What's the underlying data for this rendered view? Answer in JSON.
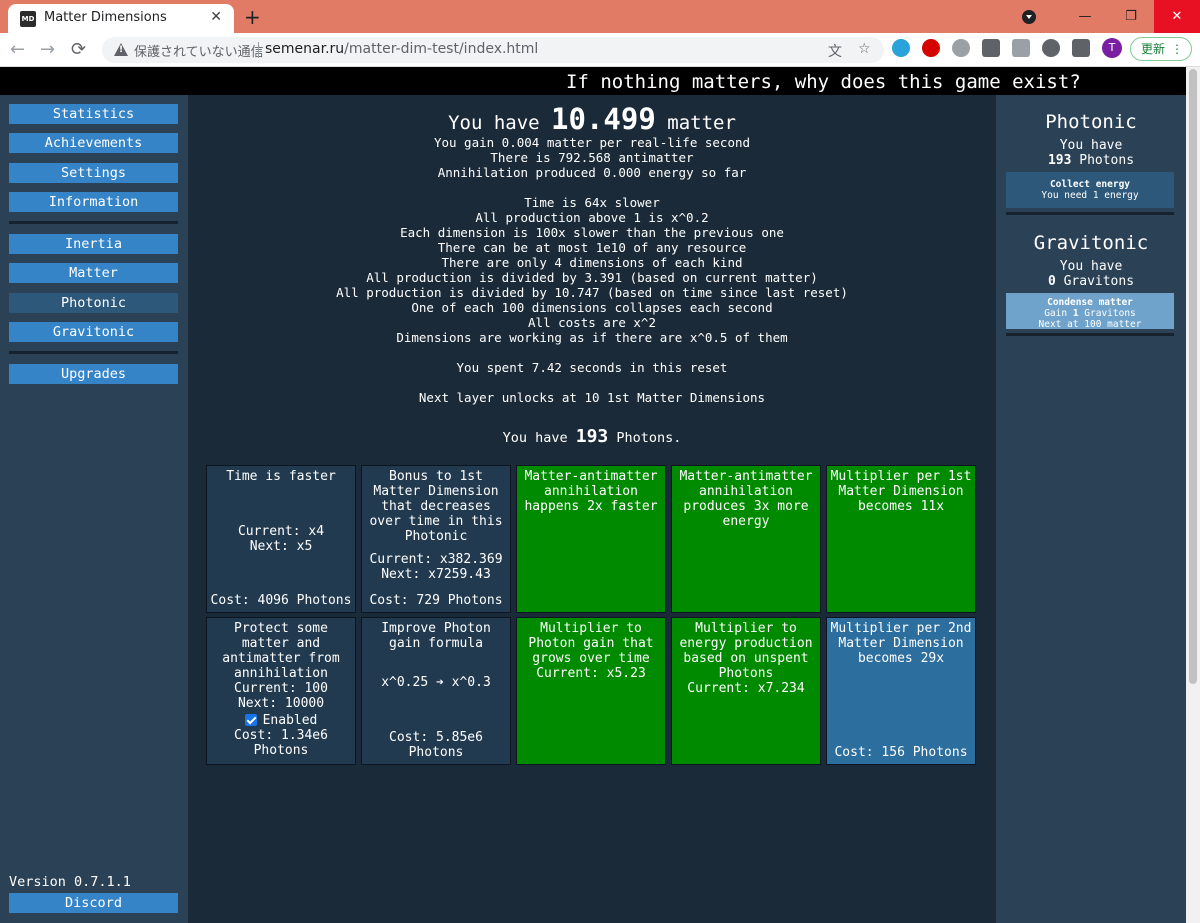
{
  "browser": {
    "tab_favicon": "MD",
    "tab_title": "Matter Dimensions",
    "tab_close": "✕",
    "new_tab": "+",
    "minimize": "—",
    "restore": "❐",
    "close": "✕",
    "back": "←",
    "forward": "→",
    "reload": "⟳",
    "security_text": "保護されていない通信",
    "url_host": "semenar.ru",
    "url_path": "/matter-dim-test/index.html",
    "translate_icon": "文",
    "star_icon": "☆",
    "avatar_letter": "T",
    "update_label": "更新"
  },
  "header": {
    "motto": "If nothing matters, why does this game exist?"
  },
  "sidebar": {
    "buttons": [
      "Statistics",
      "Achievements",
      "Settings",
      "Information",
      "Inertia",
      "Matter",
      "Photonic",
      "Gravitonic",
      "Upgrades"
    ],
    "active": "Photonic",
    "version": "Version 0.7.1.1",
    "discord": "Discord"
  },
  "main": {
    "have_prefix": "You have",
    "matter_amount": "10.499",
    "have_suffix": "matter",
    "gain_line": "You gain 0.004 matter per real-life second",
    "antimatter_line": "There is 792.568 antimatter",
    "annihilation_line": "Annihilation produced 0.000 energy so far",
    "rules": [
      "Time is 64x slower",
      "All production above 1 is x^0.2",
      "Each dimension is 100x slower than the previous one",
      "There can be at most 1e10 of any resource",
      "There are only 4 dimensions of each kind",
      "All production is divided by 3.391 (based on current matter)",
      "All production is divided by 10.747 (based on time since last reset)",
      "One of each 100 dimensions collapses each second",
      "All costs are x^2",
      "Dimensions are working as if there are x^0.5 of them"
    ],
    "spent_line": "You spent 7.42 seconds in this reset",
    "next_layer_line": "Next layer unlocks at 10 1st Matter Dimensions",
    "photons_prefix": "You have",
    "photons_amount": "193",
    "photons_suffix": "Photons."
  },
  "upgrades": {
    "u1": {
      "title": "Time is faster",
      "current": "Current: x4",
      "next": "Next: x5",
      "cost": "Cost: 4096 Photons"
    },
    "u2": {
      "title": "Bonus to 1st Matter Dimension that decreases over time in this Photonic",
      "current": "Current: x382.369",
      "next": "Next: x7259.43",
      "cost": "Cost: 729 Photons"
    },
    "u3": {
      "title": "Matter-antimatter annihilation happens 2x faster"
    },
    "u4": {
      "title": "Matter-antimatter annihilation produces 3x more energy"
    },
    "u5": {
      "title": "Multiplier per 1st Matter Dimension becomes 11x"
    },
    "u6": {
      "title": "Protect some matter and antimatter from annihilation",
      "current": "Current: 100",
      "next": "Next: 10000",
      "toggle": "Enabled",
      "cost_line1": "Cost: 1.34e6",
      "cost_line2": "Photons"
    },
    "u7": {
      "title": "Improve Photon gain formula",
      "formula": "x^0.25 ➔ x^0.3",
      "cost_line1": "Cost: 5.85e6",
      "cost_line2": "Photons"
    },
    "u8": {
      "title": "Multiplier to Photon gain that grows over time",
      "current": "Current: x5.23"
    },
    "u9": {
      "title": "Multiplier to energy production based on unspent Photons",
      "current": "Current: x7.234"
    },
    "u10": {
      "title": "Multiplier per 2nd Matter Dimension becomes 29x",
      "cost": "Cost: 156 Photons"
    }
  },
  "rightbar": {
    "photonic_title": "Photonic",
    "photonic_have": "You have",
    "photons_amount": "193",
    "photons_label": "Photons",
    "collect_title": "Collect energy",
    "collect_sub": "You need 1 energy",
    "gravitonic_title": "Gravitonic",
    "gravitonic_have": "You have",
    "gravitons_amount": "0",
    "gravitons_label": "Gravitons",
    "condense_title": "Condense matter",
    "condense_gain_prefix": "Gain",
    "condense_gain_amount": "1",
    "condense_gain_suffix": "Gravitons",
    "condense_next": "Next at 100 matter"
  },
  "colors": {
    "button_blue": "#3584c7",
    "active_button": "#2d5879",
    "bought_green": "#008a00",
    "upgrade_dark": "#223a50",
    "affordable_blue": "#2c6e9e",
    "tabbar": "#e27b65"
  }
}
